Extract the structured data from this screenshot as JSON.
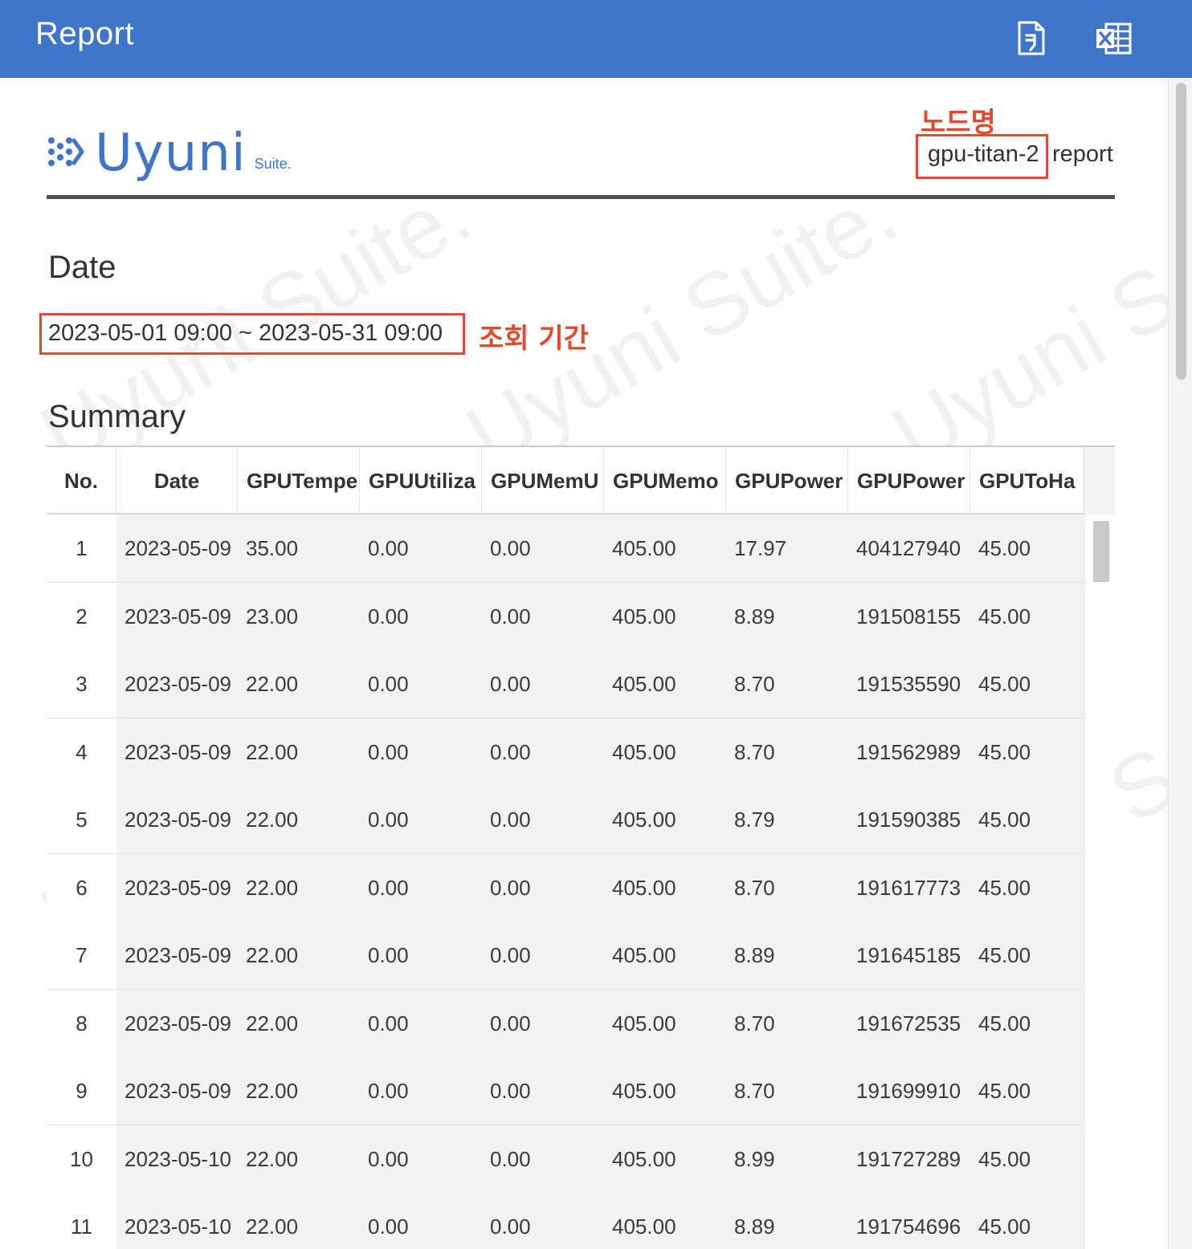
{
  "header": {
    "title": "Report",
    "pdf_icon": "file-pdf-icon",
    "excel_icon": "file-excel-icon"
  },
  "logo": {
    "name": "Uyuni",
    "suffix": "Suite."
  },
  "watermark_text": "Uyuni Suite.",
  "node": {
    "annotation": "노드명",
    "name": "gpu-titan-2",
    "suffix": "report"
  },
  "date_section": {
    "title": "Date",
    "range": "2023-05-01 09:00 ~ 2023-05-31 09:00",
    "annotation": "조회 기간"
  },
  "summary": {
    "title": "Summary",
    "columns": [
      "No.",
      "Date",
      "GPUTempe",
      "GPUUtiliza",
      "GPUMemU",
      "GPUMemo",
      "GPUPower",
      "GPUPower",
      "GPUToHa"
    ],
    "rows": [
      [
        "1",
        "2023-05-09",
        "35.00",
        "0.00",
        "0.00",
        "405.00",
        "17.97",
        "404127940",
        "45.00"
      ],
      [
        "2",
        "2023-05-09",
        "23.00",
        "0.00",
        "0.00",
        "405.00",
        "8.89",
        "191508155",
        "45.00"
      ],
      [
        "3",
        "2023-05-09",
        "22.00",
        "0.00",
        "0.00",
        "405.00",
        "8.70",
        "191535590",
        "45.00"
      ],
      [
        "4",
        "2023-05-09",
        "22.00",
        "0.00",
        "0.00",
        "405.00",
        "8.70",
        "191562989",
        "45.00"
      ],
      [
        "5",
        "2023-05-09",
        "22.00",
        "0.00",
        "0.00",
        "405.00",
        "8.79",
        "191590385",
        "45.00"
      ],
      [
        "6",
        "2023-05-09",
        "22.00",
        "0.00",
        "0.00",
        "405.00",
        "8.70",
        "191617773",
        "45.00"
      ],
      [
        "7",
        "2023-05-09",
        "22.00",
        "0.00",
        "0.00",
        "405.00",
        "8.89",
        "191645185",
        "45.00"
      ],
      [
        "8",
        "2023-05-09",
        "22.00",
        "0.00",
        "0.00",
        "405.00",
        "8.70",
        "191672535",
        "45.00"
      ],
      [
        "9",
        "2023-05-09",
        "22.00",
        "0.00",
        "0.00",
        "405.00",
        "8.70",
        "191699910",
        "45.00"
      ],
      [
        "10",
        "2023-05-10",
        "22.00",
        "0.00",
        "0.00",
        "405.00",
        "8.99",
        "191727289",
        "45.00"
      ],
      [
        "11",
        "2023-05-10",
        "22.00",
        "0.00",
        "0.00",
        "405.00",
        "8.89",
        "191754696",
        "45.00"
      ]
    ]
  },
  "colors": {
    "header_bg": "#3f75c9",
    "annotation": "#e04a2e",
    "brand": "#3f75c9"
  }
}
